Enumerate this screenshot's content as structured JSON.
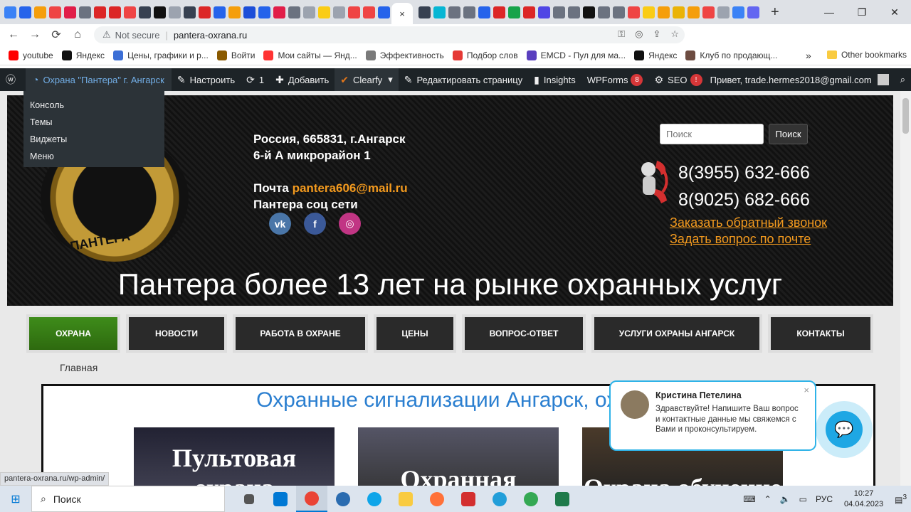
{
  "browser": {
    "active_tab_close": "×",
    "new_tab": "+",
    "window_controls": [
      "—",
      "❐",
      "✕"
    ],
    "nav": {
      "back": "←",
      "forward": "→",
      "reload": "⟳",
      "home": "⌂"
    },
    "address": {
      "security": "Not secure",
      "url": "pantera-oxrana.ru"
    },
    "bookmarks": [
      {
        "label": "youtube",
        "color": "#ff0000"
      },
      {
        "label": "Яндекс",
        "color": "#111111"
      },
      {
        "label": "Цены, графики и р...",
        "color": "#3c6fd6"
      },
      {
        "label": "Войти",
        "color": "#8a5a00"
      },
      {
        "label": "Мои сайты — Янд...",
        "color": "#ff3333"
      },
      {
        "label": "Эффективность",
        "color": "#7a7a7a"
      },
      {
        "label": "Подбор слов",
        "color": "#e53935"
      },
      {
        "label": "EMCD - Пул для ма...",
        "color": "#5a3fbf"
      },
      {
        "label": "Яндекс",
        "color": "#111111"
      },
      {
        "label": "Клуб по продающ...",
        "color": "#6d4c41"
      }
    ],
    "bookmarks_more": "»",
    "other_bookmarks": "Other bookmarks",
    "status_url": "pantera-oxrana.ru/wp-admin/"
  },
  "wpbar": {
    "site": "Охрана \"Пантера\" г. Ангарск",
    "customize": "Настроить",
    "updates": "1",
    "add": "Добавить",
    "clearfy": "Clearfy",
    "edit_page": "Редактировать страницу",
    "insights": "Insights",
    "wpforms": "WPForms",
    "wpforms_badge": "8",
    "seo": "SEO",
    "seo_badge": "!",
    "greeting": "Привет, trade.hermes2018@gmail.com",
    "dropdown": [
      "Консоль",
      "Темы",
      "Виджеты",
      "Меню"
    ]
  },
  "header": {
    "logo_text": "ПАНТЕРА",
    "address_line1": "Россия, 665831, г.Ангарск",
    "address_line2": "6-й А микрорайон 1",
    "mail_label": "Почта",
    "mail": "pantera606@mail.ru",
    "social_label": "Пантера соц сети",
    "social": [
      {
        "name": "vk",
        "glyph": "vk",
        "color": "#4a76a8"
      },
      {
        "name": "facebook",
        "glyph": "f",
        "color": "#3b5998"
      },
      {
        "name": "instagram",
        "glyph": "◎",
        "color": "#c13584"
      }
    ],
    "search_placeholder": "Поиск",
    "search_button": "Поиск",
    "phone1": "8(3955) 632-666",
    "phone2": "8(9025) 682-666",
    "link_callback": "Заказать обратный звонок",
    "link_question": "Задать вопрос по почте",
    "slogan": "Пантера более 13 лет на рынке охранных услуг"
  },
  "menu": [
    {
      "label": "ОХРАНА",
      "active": true
    },
    {
      "label": "НОВОСТИ"
    },
    {
      "label": "РАБОТА В ОХРАНЕ"
    },
    {
      "label": "ЦЕНЫ"
    },
    {
      "label": "ВОПРОС-ОТВЕТ"
    },
    {
      "label": "УСЛУГИ ОХРАНЫ АНГАРСК"
    },
    {
      "label": "КОНТАКТЫ"
    }
  ],
  "breadcrumb": "Главная",
  "content": {
    "heading": "Охранные сигнализации Ангарск, охрана",
    "cards": [
      "Пультовая охрана",
      "Охранная",
      "Охрана обучение"
    ]
  },
  "chat": {
    "name": "Кристина Петелина",
    "message": "Здравствуйте! Напишите Ваш вопрос и контактные данные мы свяжемся с Вами и проконсультируем.",
    "close": "×"
  },
  "taskbar": {
    "search": "Поиск",
    "lang": "РУС",
    "time": "10:27",
    "date": "04.04.2023",
    "notifications": "3"
  },
  "colors": {
    "wp_bar": "#1d2327",
    "accent_orange": "#f39a1e",
    "heading_blue": "#2b7fd0",
    "menu_active_green": "#3e8c1a",
    "chat_blue": "#1ea7e4"
  }
}
